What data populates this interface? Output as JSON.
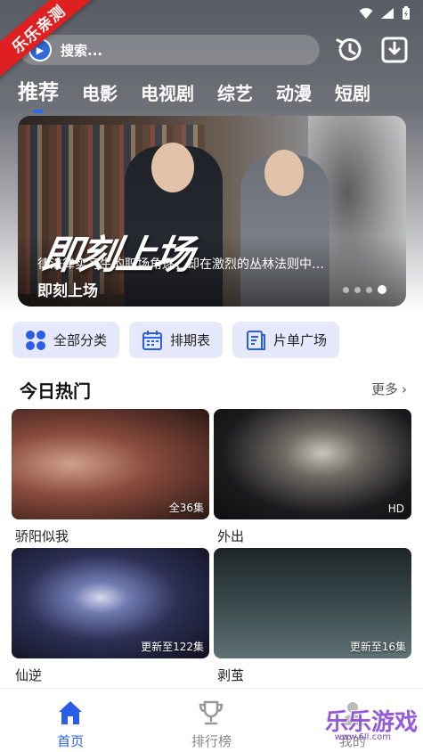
{
  "corner_ribbon": "乐乐亲测",
  "search": {
    "placeholder": "搜索..."
  },
  "tabs": [
    "推荐",
    "电影",
    "电视剧",
    "综艺",
    "动漫",
    "短剧"
  ],
  "banner": {
    "logo_text": "即刻上场",
    "description": "律法律实习生的职场角逐，却在激烈的丛林法则中…",
    "title": "即刻上场",
    "active_dot": 4,
    "dot_count": 4
  },
  "quick_buttons": [
    "全部分类",
    "排期表",
    "片单广场"
  ],
  "section": {
    "title": "今日热门",
    "more": "更多"
  },
  "cards": [
    {
      "title": "骄阳似我",
      "badge": "全36集"
    },
    {
      "title": "外出",
      "badge": "HD"
    },
    {
      "title": "仙逆",
      "badge": "更新至122集"
    },
    {
      "title": "剥茧",
      "badge": "更新至16集"
    }
  ],
  "bottom_nav": [
    {
      "label": "首页",
      "active": true
    },
    {
      "label": "排行榜",
      "active": false
    },
    {
      "label": "我的",
      "active": false
    }
  ],
  "colors": {
    "accent": "#2b5ee8",
    "ribbon": "#e02020",
    "quick_bg": "#e6e9fb"
  },
  "watermark": {
    "main": "乐乐游戏",
    "sub": "www.6ll.com"
  }
}
